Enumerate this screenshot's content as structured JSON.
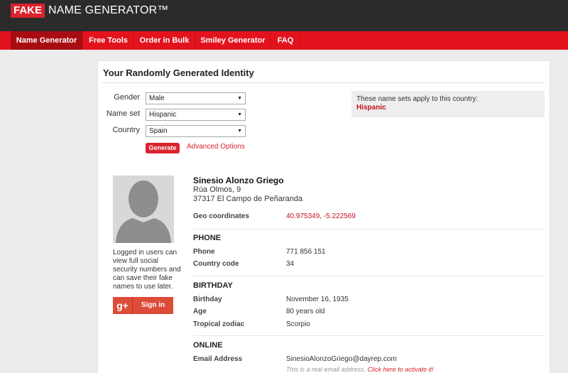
{
  "header": {
    "logo_fake": "FAKE",
    "logo_rest": "NAME GENERATOR™"
  },
  "nav": {
    "items": [
      {
        "label": "Name Generator",
        "active": true
      },
      {
        "label": "Free Tools",
        "active": false
      },
      {
        "label": "Order in Bulk",
        "active": false
      },
      {
        "label": "Smiley Generator",
        "active": false
      },
      {
        "label": "FAQ",
        "active": false
      }
    ]
  },
  "card": {
    "title": "Your Randomly Generated Identity"
  },
  "form": {
    "gender": {
      "label": "Gender",
      "value": "Male"
    },
    "name_set": {
      "label": "Name set",
      "value": "Hispanic"
    },
    "country": {
      "label": "Country",
      "value": "Spain"
    },
    "generate_label": "Generate",
    "advanced_label": "Advanced Options"
  },
  "info": {
    "text": "These name sets apply to this country:",
    "country": "Hispanic"
  },
  "sidebar": {
    "note": "Logged in users can view full social security numbers and can save their fake names to use later.",
    "google_icon": "g+",
    "signin_label": "Sign in"
  },
  "identity": {
    "name": "Sinesio Alonzo Griego",
    "address_line1": "Rúa Olmos, 9",
    "address_line2": "37317 El Campo de Peñaranda",
    "geo_label": "Geo coordinates",
    "geo_value": "40.975349, -5.222569"
  },
  "phone": {
    "heading": "PHONE",
    "phone_label": "Phone",
    "phone_value": "771 856 151",
    "code_label": "Country code",
    "code_value": "34"
  },
  "birthday": {
    "heading": "BIRTHDAY",
    "birthday_label": "Birthday",
    "birthday_value": "November 16, 1935",
    "age_label": "Age",
    "age_value": "80 years old",
    "zodiac_label": "Tropical zodiac",
    "zodiac_value": "Scorpio"
  },
  "online": {
    "heading": "ONLINE",
    "email_label": "Email Address",
    "email_value": "SinesioAlonzoGriego@dayrep.com",
    "note_text": "This is a real email address.",
    "note_link": "Click here to activate it!"
  },
  "colors": {
    "brand_red": "#e3131d",
    "dark_header": "#2b2b2b",
    "active_nav": "#a90d14",
    "link_red": "#d9232d",
    "google_red": "#dd4b39"
  }
}
